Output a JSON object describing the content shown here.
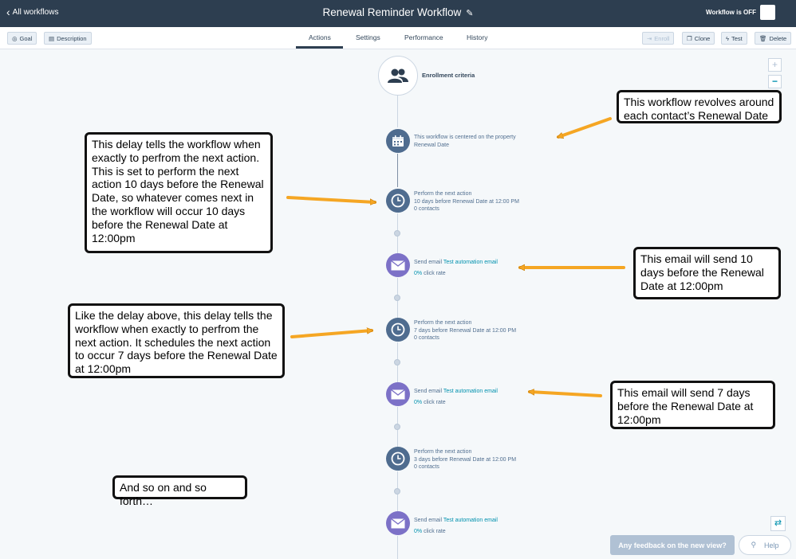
{
  "topbar": {
    "back_label": "All workflows",
    "title": "Renewal Reminder Workflow",
    "status": "Workflow is OFF"
  },
  "toolbar": {
    "goal_label": "Goal",
    "description_label": "Description",
    "enroll_label": "Enroll",
    "clone_label": "Clone",
    "test_label": "Test",
    "delete_label": "Delete"
  },
  "tabs": [
    {
      "label": "Actions",
      "active": true
    },
    {
      "label": "Settings",
      "active": false
    },
    {
      "label": "Performance",
      "active": false
    },
    {
      "label": "History",
      "active": false
    }
  ],
  "enrollment": {
    "label": "Enrollment criteria"
  },
  "nodes": [
    {
      "type": "date",
      "line1": "This workflow is centered on the property",
      "line2": "Renewal Date"
    },
    {
      "type": "delay",
      "line1": "Perform the next action",
      "line2": "10 days before Renewal Date at 12:00 PM",
      "line3": "0 contacts"
    },
    {
      "type": "email",
      "prefix": "Send email",
      "link": "Test automation email",
      "pct": "0%",
      "rate": "click rate"
    },
    {
      "type": "delay",
      "line1": "Perform the next action",
      "line2": "7 days before Renewal Date at 12:00 PM",
      "line3": "0 contacts"
    },
    {
      "type": "email",
      "prefix": "Send email",
      "link": "Test automation email",
      "pct": "0%",
      "rate": "click rate"
    },
    {
      "type": "delay",
      "line1": "Perform the next action",
      "line2": "3 days before Renewal Date at 12:00 PM",
      "line3": "0 contacts"
    },
    {
      "type": "email",
      "prefix": "Send email",
      "link": "Test automation email",
      "pct": "0%",
      "rate": "click rate"
    }
  ],
  "callouts": {
    "c1": "This workflow revolves around each contact’s Renewal Date",
    "c2": "This delay tells the workflow when exactly to perfrom the next action. This is set to perform the next action 10 days before the Renewal Date, so whatever comes next in the workflow will occur 10 days before the Renewal Date at 12:00pm",
    "c3": "This email will send 10 days before the Renewal Date at 12:00pm",
    "c4": "Like the delay above, this delay tells the workflow when exactly to perfrom the next action. It schedules the next action to occur 7 days before the Renewal Date at 12:00pm",
    "c5": "This email will send 7 days before the Renewal Date at 12:00pm",
    "c6": "And so on and so forth…"
  },
  "controls": {
    "zoom_in": "+",
    "zoom_out": "−",
    "feedback": "Any feedback on the new view?",
    "help": "Help"
  },
  "colors": {
    "topbar": "#2d3e50",
    "node_slate": "#4f6c8f",
    "node_purple": "#7c71c7",
    "link": "#0091ae",
    "arrow": "#f5a623"
  },
  "icons": {
    "enrollment": "contacts-icon",
    "date": "calendar-icon",
    "delay": "clock-icon",
    "email": "envelope-icon"
  }
}
